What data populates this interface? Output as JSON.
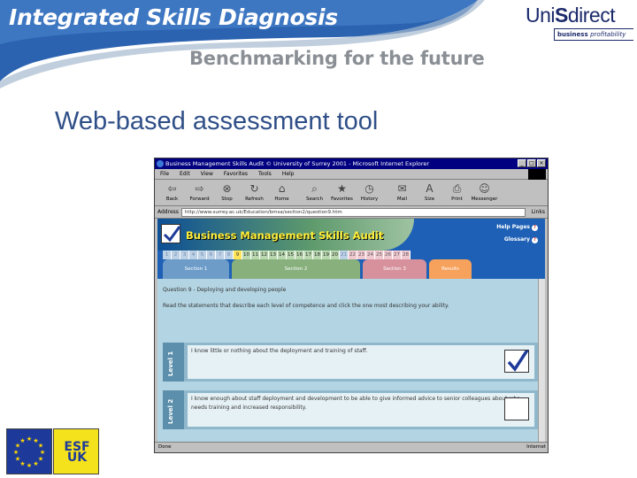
{
  "header": {
    "title": "Integrated Skills Diagnosis",
    "subtitle": "Benchmarking for the future"
  },
  "logo": {
    "word_part1": "Uni",
    "word_part2": "S",
    "word_part3": "direct",
    "tagline_part1": "business ",
    "tagline_part2": "profitability"
  },
  "slide": {
    "title": "Web-based assessment tool"
  },
  "esf": {
    "label_top": "ESF",
    "label_bottom": "UK"
  },
  "browser": {
    "window_title": "Business Management Skills Audit © University of Surrey 2001 - Microsoft Internet Explorer",
    "menu": [
      "File",
      "Edit",
      "View",
      "Favorites",
      "Tools",
      "Help"
    ],
    "toolbar": [
      {
        "label": "Back",
        "icon": "back-arrow-icon"
      },
      {
        "label": "Forward",
        "icon": "forward-arrow-icon"
      },
      {
        "label": "Stop",
        "icon": "stop-icon"
      },
      {
        "label": "Refresh",
        "icon": "refresh-icon"
      },
      {
        "label": "Home",
        "icon": "home-icon"
      },
      {
        "label": "Search",
        "icon": "search-icon"
      },
      {
        "label": "Favorites",
        "icon": "favorites-icon"
      },
      {
        "label": "History",
        "icon": "history-icon"
      },
      {
        "label": "Mail",
        "icon": "mail-icon"
      },
      {
        "label": "Size",
        "icon": "size-icon"
      },
      {
        "label": "Print",
        "icon": "print-icon"
      },
      {
        "label": "Messenger",
        "icon": "messenger-icon"
      }
    ],
    "address_label": "Address",
    "address_value": "http://www.surrey.ac.uk/Education/bmsa/section2/question9.htm",
    "links_label": "Links",
    "status_left": "Done",
    "status_right": "Internet"
  },
  "app": {
    "title": "Business Management Skills Audit",
    "help_pages": "Help Pages",
    "glossary": "Glossary",
    "question_numbers": [
      "1",
      "2",
      "3",
      "4",
      "5",
      "6",
      "7",
      "8",
      "9",
      "10",
      "11",
      "12",
      "13",
      "14",
      "15",
      "16",
      "17",
      "18",
      "19",
      "20",
      "21",
      "22",
      "23",
      "24",
      "25",
      "26",
      "27",
      "28"
    ],
    "active_question": "9",
    "tabs": [
      "Section 1",
      "Section 2",
      "Section 3",
      "Results"
    ],
    "question_heading": "Question 9 - Deploying and developing people",
    "instructions": "Read the statements that describe each level of competence and click the one most describing your ability.",
    "levels": [
      {
        "label": "Level 1",
        "text": "I know little or nothing about the deployment and training of staff.",
        "checked": true
      },
      {
        "label": "Level 2",
        "text": "I know enough about staff deployment and development to be able to give informed advice to senior colleagues about who needs training and increased responsibility.",
        "checked": false
      }
    ]
  },
  "colors": {
    "banner_blue": "#2b63b0",
    "subtitle_gray": "#8a8f95",
    "title_blue": "#2f4f88",
    "app_header": "#1d60b5",
    "app_title_yellow": "#ffef3a"
  }
}
